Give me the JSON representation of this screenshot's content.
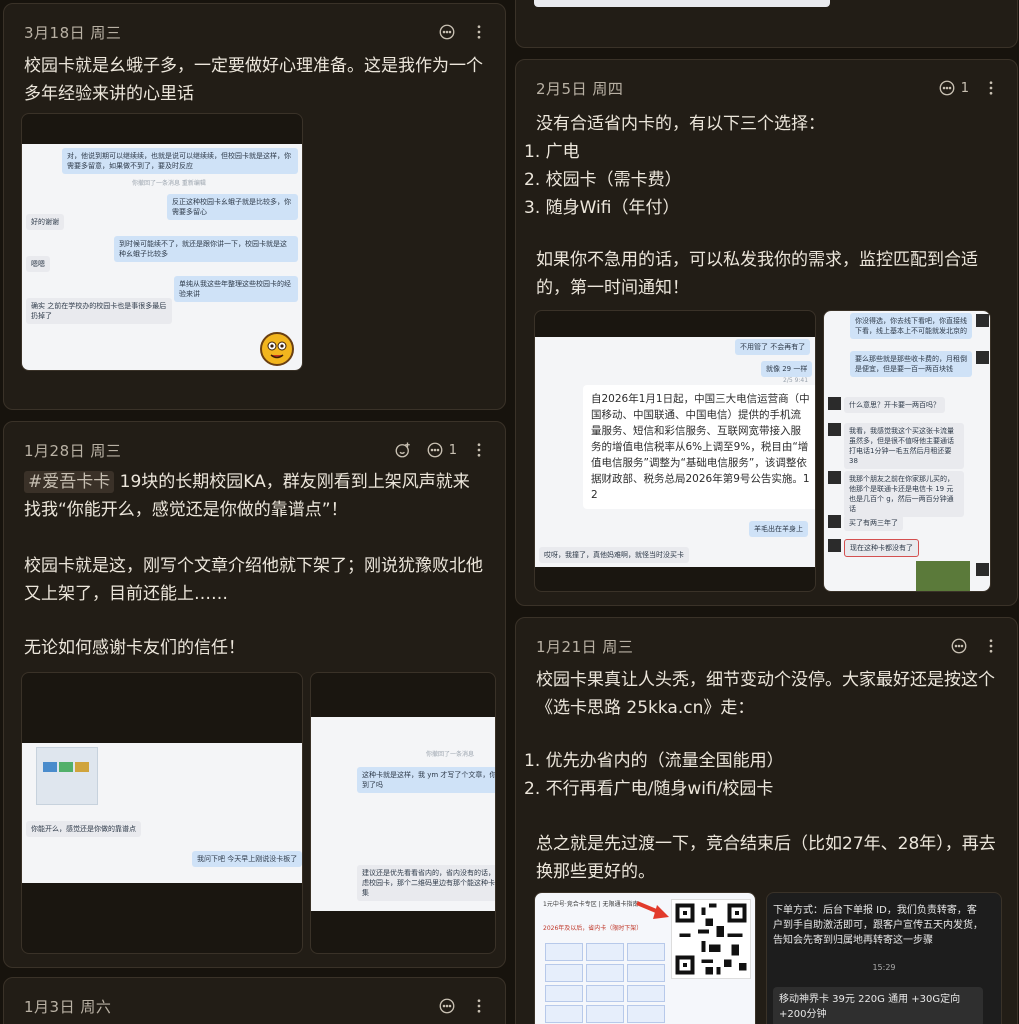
{
  "cards": {
    "c1": {
      "date": "3月18日 周三",
      "text": "校园卡就是幺蛾子多，一定要做好心理准备。这是我作为一个多年经验来讲的心里话",
      "shot": {
        "b1": "对，他说到期可以继续续，也就是说可以继续续，但校园卡就是这样，你需要多留意，如果做不到了，要及时反应",
        "recall": "你撤回了一条消息 重新编辑",
        "b2": "反正这种校园卡幺蛾子就是比较多，你需要多留心",
        "b3": "好的谢谢",
        "b4": "到时候可能续不了，就还是跟你讲一下，校园卡就是这种幺蛾子比较多",
        "b5": "嗯嗯",
        "b6": "单纯从我这些年整理这些校园卡的经验来讲",
        "b7": "确实 之前在学校办的校园卡也是事很多最后扔掉了"
      }
    },
    "c2": {
      "date": "1月28日 周三",
      "comment_count": "1",
      "tag": "#爱吾卡卡",
      "text1": " 19块的长期校园KA，群友刚看到上架风声就来找我“你能开么，感觉还是你做的靠谱点”！",
      "text2": "校园卡就是这，刚写个文章介绍他就下架了；刚说犹豫败北他又上架了，目前还能上……",
      "text3": "无论如何感谢卡友们的信任！",
      "shot1": {
        "b1": "你能开么，感觉还是你做的靠谱点",
        "b2": "我问下吧 今天早上刚说没卡板了"
      },
      "shot2": {
        "recall": "你撤回了一条消息",
        "b1": "这种卡就是这样，我 ym 才写了个文章，你就看到了吗",
        "b2": "建议还是优先看看省内的，省内没有的话，再考虑校园卡，那个二维码里边有那个能这种卡的合集"
      }
    },
    "c3": {
      "date": "1月3日 周六"
    },
    "c4": {
      "date": "2月5日 周四",
      "comment_count": "1",
      "intro": "没有合适省内卡的，有以下三个选择：",
      "items": [
        "1.  广电",
        "2.  校园卡（需卡费）",
        "3.  随身Wifi（年付）"
      ],
      "text2": "如果你不急用的话，可以私发我你的需求，监控匹配到合适的，第一时间通知！",
      "shot1": {
        "b1": "不用管了 不会再有了",
        "b2": "就像 29 一样",
        "time": "2/5 9:41",
        "notice": "自2026年1月1日起，中国三大电信运营商（中国移动、中国联通、中国电信）提供的手机流量服务、短信和彩信服务、互联网宽带接入服务的增值电信税率从6%上调至9%，税目由“增值电信服务”调整为“基础电信服务”，该调整依据财政部、税务总局2026年第9号公告实施。1  2",
        "b3": "羊毛出在羊身上",
        "b4": "哎呀，我撞了，真他妈难啊，就怪当时没买卡"
      },
      "shot2": {
        "b1": "你没得选，你去线下看吧，你直接线下看，线上基本上不可能就发北京的",
        "b2": "要么那些就是那些收卡费的，月租倒是便宜，但是要一百一两百块钱",
        "b3": "什么意思？开卡要一两百吗？",
        "b4": "我看，我感觉我这个买这张卡流量虽然多，但是很不值呀他主要通话打电话1分钟一毛五然后月租还要38",
        "b5": "我那个朋友之前在你家那儿买的，他那个是联通卡还是电信卡 19 元也是几百个 g，然后一两百分钟通话",
        "b6": "买了有两三年了",
        "b7": "现在这种卡都没有了"
      }
    },
    "c5": {
      "date": "1月21日 周三",
      "text1": "校园卡果真让人头秃，细节变动个没停。大家最好还是按这个《选卡思路 25kka.cn》走：",
      "items": [
        "1.  优先办省内的（流量全国能用）",
        "2.  不行再看广电/随身wifi/校园卡"
      ],
      "text2": "总之就是先过渡一下，竞合结束后（比如27年、28年），再去换那些更好的。",
      "shot1": {
        "title": "1元中号·竞合卡专区 | 无限通卡指南",
        "hint": "2026年及以后，省内卡（限时下架）"
      },
      "shot2": {
        "text": "下单方式：后台下单报 ID，我们负责转寄，客户到手自助激活即可，跟客户宣传五天内发货，告知会先寄到归属地再转寄这一步骤",
        "time": "15:29",
        "b2": "移动神界卡 39元 220G 通用 +30G定向 +200分钟"
      }
    }
  },
  "colors": {
    "page_bg": "#17130d",
    "card_bg": "#221d16",
    "bubble_right": "#cfe2f7",
    "bubble_left": "#e9eaee",
    "tag_bg": "#3a3128"
  },
  "icons": [
    "comment-icon",
    "more-vertical-icon",
    "emoji-add-icon",
    "qr-code",
    "red-arrow-icon"
  ]
}
